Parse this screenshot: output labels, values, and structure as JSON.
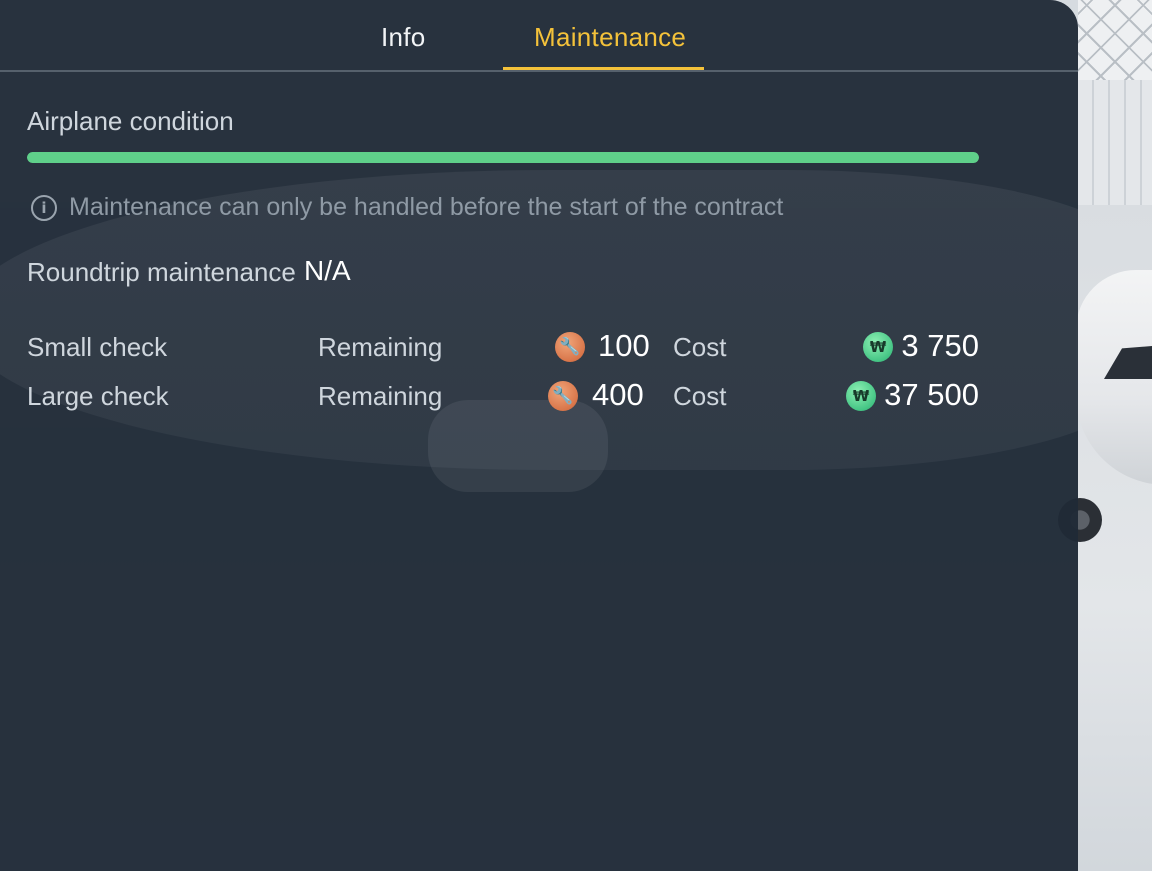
{
  "tabs": [
    {
      "label": "Info",
      "active": false
    },
    {
      "label": "Maintenance",
      "active": true
    }
  ],
  "condition": {
    "title": "Airplane condition",
    "level_percent": 100,
    "bar_color": "#5fd08a"
  },
  "notice": {
    "icon": "info-icon",
    "text": "Maintenance can only be handled before the start of the contract"
  },
  "roundtrip": {
    "label": "Roundtrip maintenance",
    "value": "N/A"
  },
  "checks": [
    {
      "name": "Small check",
      "remaining_label": "Remaining",
      "remaining_icon": "wrench-icon",
      "remaining_value": "100",
      "cost_label": "Cost",
      "cost_icon": "money-icon",
      "cost_value": "3 750"
    },
    {
      "name": "Large check",
      "remaining_label": "Remaining",
      "remaining_icon": "wrench-icon",
      "remaining_value": "400",
      "cost_label": "Cost",
      "cost_icon": "money-icon",
      "cost_value": "37 500"
    }
  ],
  "colors": {
    "accent": "#f4c23a",
    "panel": "#1f2a36",
    "wrench": "#d9764a",
    "money": "#45c585"
  }
}
